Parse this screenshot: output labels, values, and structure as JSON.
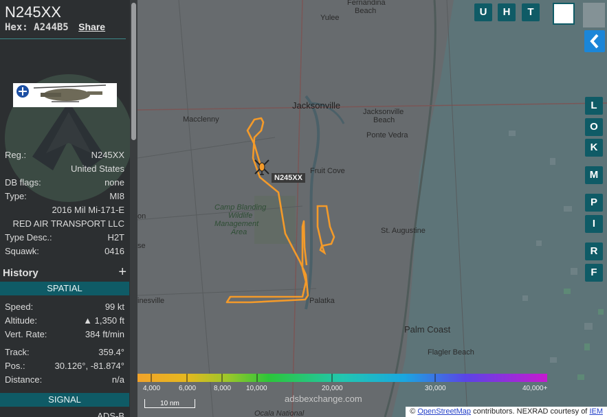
{
  "aircraft": {
    "registration_title": "N245XX",
    "hex_label": "Hex:",
    "hex": "A244B5",
    "share_label": "Share",
    "map_label": "N245XX"
  },
  "details": {
    "reg_label": "Reg.:",
    "reg_value": "N245XX",
    "country": "United States",
    "dbflags_label": "DB flags:",
    "dbflags_value": "none",
    "type_label": "Type:",
    "type_value": "MI8",
    "model": "2016 Mil Mi-171-E",
    "owner": "RED AIR TRANSPORT LLC",
    "typedesc_label": "Type Desc.:",
    "typedesc_value": "H2T",
    "squawk_label": "Squawk:",
    "squawk_value": "0416"
  },
  "history": {
    "label": "History",
    "plus": "+"
  },
  "spatial": {
    "section_label": "SPATIAL",
    "speed_label": "Speed:",
    "speed_value": "99 kt",
    "altitude_label": "Altitude:",
    "altitude_value": "▲ 1,350 ft",
    "vertrate_label": "Vert. Rate:",
    "vertrate_value": "384 ft/min",
    "track_label": "Track:",
    "track_value": "359.4°",
    "pos_label": "Pos.:",
    "pos_value": "30.126°, -81.874°",
    "distance_label": "Distance:",
    "distance_value": "n/a"
  },
  "signal": {
    "section_label": "SIGNAL",
    "source_partial": "ADS-B"
  },
  "map": {
    "top_buttons": [
      "U",
      "H",
      "T"
    ],
    "right_buttons": [
      "L",
      "O",
      "K",
      "M",
      "P",
      "I",
      "R",
      "F"
    ],
    "places": [
      {
        "name": "Fernandina"
      },
      {
        "name": "Beach"
      },
      {
        "name": "Yulee"
      },
      {
        "name": "Jacksonville"
      },
      {
        "name": "Macclenny"
      },
      {
        "name": "Jacksonville"
      },
      {
        "name": "Beach"
      },
      {
        "name": "Ponte Vedra"
      },
      {
        "name": "Fruit Cove"
      },
      {
        "name": "Camp Blanding"
      },
      {
        "name": "Wildlife"
      },
      {
        "name": "Management"
      },
      {
        "name": "Area"
      },
      {
        "name": "St. Augustine"
      },
      {
        "name": "Palatka"
      },
      {
        "name": "Palm Coast"
      },
      {
        "name": "Flagler Beach"
      },
      {
        "name": "inesville"
      },
      {
        "name": "Ocala National"
      },
      {
        "name": "on"
      },
      {
        "name": "se"
      }
    ],
    "altitude_legend": [
      "4,000",
      "6,000",
      "8,000",
      "10,000",
      "20,000",
      "30,000",
      "40,000+"
    ],
    "scale_label": "10 nm",
    "watermark": "adsbexchange.com",
    "attribution_prefix": "©",
    "attribution_osm": "OpenStreetMap",
    "attribution_mid": "contributors. NEXRAD courtesy of",
    "attribution_iem": "IEM"
  },
  "colors": {
    "accent": "#0f5b66",
    "track": "#f39a2a",
    "sidebar": "#2c2f31"
  }
}
